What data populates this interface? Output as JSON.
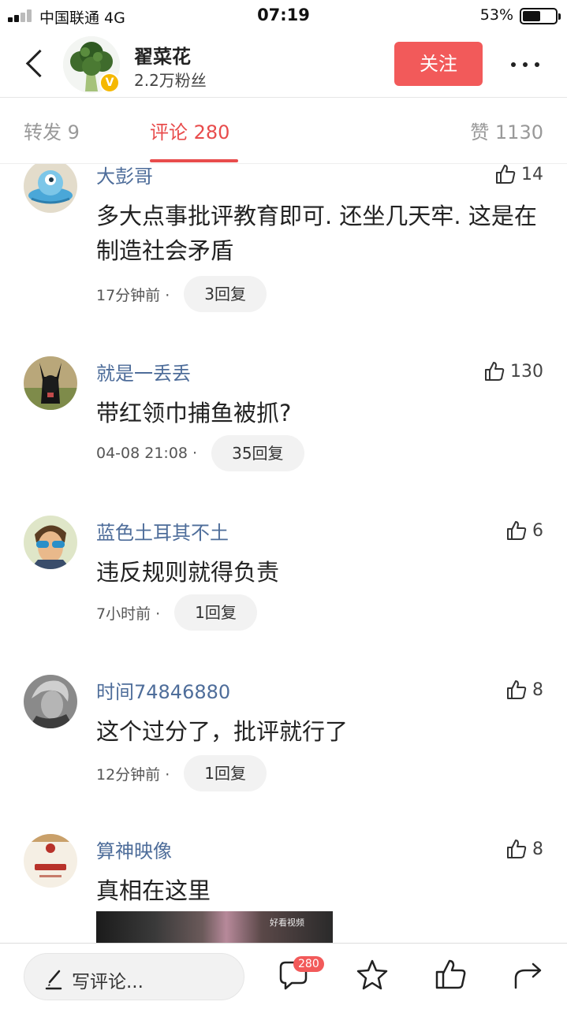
{
  "status_bar": {
    "carrier": "中国联通  4G",
    "time": "07:19",
    "battery": "53%"
  },
  "header": {
    "name": "翟菜花",
    "followers": "2.2万粉丝",
    "follow_label": "关注",
    "verified_mark": "V"
  },
  "tabs": [
    {
      "label": "转发 9"
    },
    {
      "label": "评论 280"
    },
    {
      "label": "赞 1130"
    }
  ],
  "comments": [
    {
      "user": "大彭哥",
      "likes": "14",
      "text": "多大点事批评教育即可. 还坐几天牢. 这是在制造社会矛盾",
      "time": "17分钟前 ·",
      "replies": "3回复"
    },
    {
      "user": "就是一丢丢",
      "likes": "130",
      "text": "带红领巾捕鱼被抓?",
      "time": "04-08 21:08 ·",
      "replies": "35回复"
    },
    {
      "user": "蓝色土耳其不土",
      "likes": "6",
      "text": "违反规则就得负责",
      "time": "7小时前 ·",
      "replies": "1回复"
    },
    {
      "user": "时间74846880",
      "likes": "8",
      "text": "这个过分了，批评就行了",
      "time": "12分钟前 ·",
      "replies": "1回复"
    },
    {
      "user": "算神映像",
      "likes": "8",
      "text": "真相在这里",
      "video_label": "好看视频"
    }
  ],
  "bottom_bar": {
    "write_placeholder": "写评论...",
    "comment_count": "280"
  },
  "colors": {
    "accent": "#f25a5a",
    "username": "#4e6d9a",
    "tab_active": "#e84c4c"
  }
}
